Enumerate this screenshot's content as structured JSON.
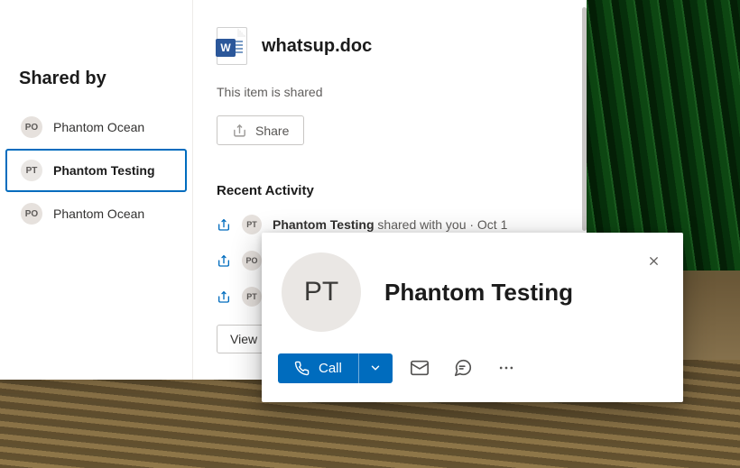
{
  "sidebar": {
    "heading": "Shared by",
    "people": [
      {
        "initials": "PO",
        "name": "Phantom Ocean",
        "selected": false
      },
      {
        "initials": "PT",
        "name": "Phantom Testing",
        "selected": true
      },
      {
        "initials": "PO",
        "name": "Phantom Ocean",
        "selected": false
      }
    ]
  },
  "file": {
    "name": "whatsup.doc",
    "icon": "word-document-icon",
    "badge_letter": "W"
  },
  "status": {
    "shared_text": "This item is shared",
    "share_button": "Share"
  },
  "recent": {
    "heading": "Recent Activity",
    "items": [
      {
        "initials": "PT",
        "who": "Phantom Testing",
        "rest": " shared with you · Oct 1"
      },
      {
        "initials": "PO",
        "who": "",
        "rest": ""
      },
      {
        "initials": "PT",
        "who": "",
        "rest": ""
      }
    ],
    "view_button": "View"
  },
  "contact_card": {
    "initials": "PT",
    "name": "Phantom Testing",
    "call_label": "Call"
  },
  "colors": {
    "accent": "#006cbe",
    "word_blue": "#2b579a"
  }
}
